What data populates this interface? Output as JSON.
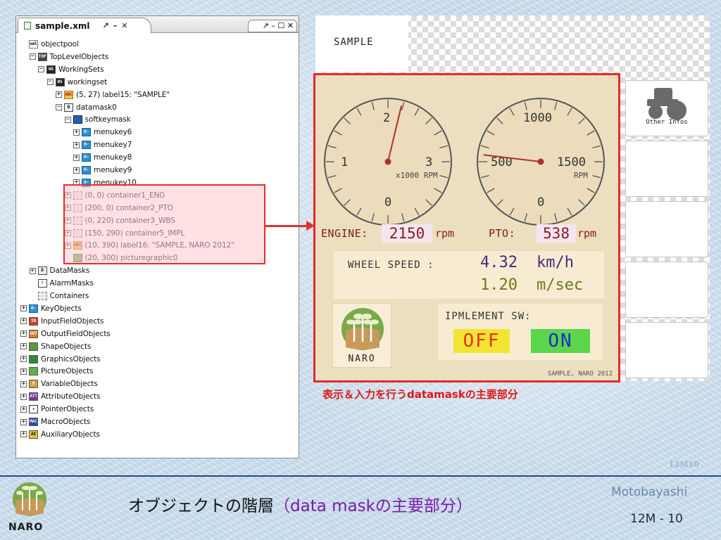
{
  "tab": {
    "title": "sample.xml",
    "controls": [
      "↗",
      "–",
      "✕"
    ],
    "second_tab_controls": "↗ – ☐ ✕"
  },
  "tree": [
    {
      "indent": 0,
      "expander": "none",
      "icon": "ico-xml",
      "icon_text": "xml",
      "label": "objectpool"
    },
    {
      "indent": 1,
      "expander": "−",
      "icon": "ico-top",
      "icon_text": "TOP",
      "label": "TopLevelObjects"
    },
    {
      "indent": 2,
      "expander": "−",
      "icon": "ico-ws",
      "icon_text": "WS",
      "label": "WorkingSets"
    },
    {
      "indent": 3,
      "expander": "−",
      "icon": "ico-ws",
      "icon_text": "WS",
      "label": "workingset"
    },
    {
      "indent": 4,
      "expander": "+",
      "icon": "ico-abc",
      "icon_text": "ABC",
      "label": "(5, 27) label15: \"SAMPLE\""
    },
    {
      "indent": 4,
      "expander": "−",
      "icon": "ico-dm",
      "icon_text": "D",
      "label": "datamask0"
    },
    {
      "indent": 5,
      "expander": "−",
      "icon": "ico-sk",
      "icon_text": "",
      "label": "softkeymask"
    },
    {
      "indent": 6,
      "expander": "+",
      "icon": "ico-key",
      "icon_text": "O-",
      "label": "menukey6"
    },
    {
      "indent": 6,
      "expander": "+",
      "icon": "ico-key",
      "icon_text": "O-",
      "label": "menukey7"
    },
    {
      "indent": 6,
      "expander": "+",
      "icon": "ico-key",
      "icon_text": "O-",
      "label": "menukey8"
    },
    {
      "indent": 6,
      "expander": "+",
      "icon": "ico-key",
      "icon_text": "O-",
      "label": "menukey9"
    },
    {
      "indent": 6,
      "expander": "+",
      "icon": "ico-key",
      "icon_text": "O-",
      "label": "menukey10"
    },
    {
      "indent": 5,
      "expander": "+",
      "icon": "ico-cont",
      "icon_text": "",
      "label": "(0, 0) container1_ENG"
    },
    {
      "indent": 5,
      "expander": "+",
      "icon": "ico-cont",
      "icon_text": "",
      "label": "(200, 0) container2_PTO"
    },
    {
      "indent": 5,
      "expander": "+",
      "icon": "ico-cont",
      "icon_text": "",
      "label": "(0, 220) container3_WBS"
    },
    {
      "indent": 5,
      "expander": "+",
      "icon": "ico-cont",
      "icon_text": "",
      "label": "(150, 290) container5_IMPL"
    },
    {
      "indent": 5,
      "expander": "+",
      "icon": "ico-abc",
      "icon_text": "ABC",
      "label": "(10, 390) label16: \"SAMPLE, NARO 2012\""
    },
    {
      "indent": 5,
      "expander": "none",
      "icon": "ico-pic",
      "icon_text": "",
      "label": "(20, 300) picturegraphic0"
    },
    {
      "indent": 1,
      "expander": "+",
      "icon": "ico-dm",
      "icon_text": "D",
      "label": "DataMasks"
    },
    {
      "indent": 1,
      "expander": "none",
      "icon": "ico-alarm",
      "icon_text": "!",
      "label": "AlarmMasks"
    },
    {
      "indent": 1,
      "expander": "none",
      "icon": "ico-cont",
      "icon_text": "",
      "label": "Containers"
    },
    {
      "indent": 0,
      "expander": "+",
      "icon": "ico-key",
      "icon_text": "O-",
      "label": "KeyObjects"
    },
    {
      "indent": 0,
      "expander": "+",
      "icon": "ico-in",
      "icon_text": "IN",
      "label": "InputFieldObjects"
    },
    {
      "indent": 0,
      "expander": "+",
      "icon": "ico-out",
      "icon_text": "OUT",
      "label": "OutputFieldObjects"
    },
    {
      "indent": 0,
      "expander": "+",
      "icon": "ico-shape",
      "icon_text": "",
      "label": "ShapeObjects"
    },
    {
      "indent": 0,
      "expander": "+",
      "icon": "ico-gfx",
      "icon_text": "",
      "label": "GraphicsObjects"
    },
    {
      "indent": 0,
      "expander": "+",
      "icon": "ico-pic",
      "icon_text": "",
      "label": "PictureObjects"
    },
    {
      "indent": 0,
      "expander": "+",
      "icon": "ico-var",
      "icon_text": "X",
      "label": "VariableObjects"
    },
    {
      "indent": 0,
      "expander": "+",
      "icon": "ico-attr",
      "icon_text": "ATT",
      "label": "AttributeObjects"
    },
    {
      "indent": 0,
      "expander": "+",
      "icon": "ico-ptr",
      "icon_text": "↗",
      "label": "PointerObjects"
    },
    {
      "indent": 0,
      "expander": "+",
      "icon": "ico-macro",
      "icon_text": "MAC",
      "label": "MacroObjects"
    },
    {
      "indent": 0,
      "expander": "+",
      "icon": "ico-aux",
      "icon_text": "AX",
      "label": "AuxiliaryObjects"
    }
  ],
  "vt": {
    "sample_label": "SAMPLE",
    "softkey_other": "Other Infos",
    "engine_gauge": {
      "ticks": [
        "1",
        "2",
        "3",
        "0"
      ],
      "unit": "x1000 RPM",
      "value": 2.15,
      "min": 0,
      "max": 4
    },
    "pto_gauge": {
      "ticks": [
        "500",
        "1000",
        "1500",
        "0"
      ],
      "unit": "RPM",
      "value": 538,
      "min": 0,
      "max": 2000
    },
    "engine_label": "ENGINE:",
    "engine_value": "2150",
    "engine_unit": "rpm",
    "pto_label": "PTO:",
    "pto_value": "538",
    "pto_unit": "rpm",
    "wheel_label": "WHEEL SPEED :",
    "wheel_kmh_value": "4.32",
    "wheel_kmh_unit": "km/h",
    "wheel_ms_value": "1.20",
    "wheel_ms_unit": "m/sec",
    "naro_text": "NARO",
    "implement_label": "IPMLEMENT SW:",
    "off_label": "OFF",
    "on_label": "ON",
    "mask_caption": "SAMPLE, NARO 2012"
  },
  "red_caption": "表示＆入力を行うdatamaskの主要部分",
  "footer": {
    "slide_code": "12M10",
    "logo_text": "NARO",
    "title_main": "オブジェクトの階層",
    "title_accent": "（data maskの主要部分）",
    "author": "Motobayashi",
    "page": "12M - 10"
  },
  "colors": {
    "highlight_border": "#e23030",
    "mask_background": "#ebdfbf",
    "off_bg": "#f2e432",
    "on_bg": "#5ad64a",
    "title_accent": "#7a1aa8"
  }
}
